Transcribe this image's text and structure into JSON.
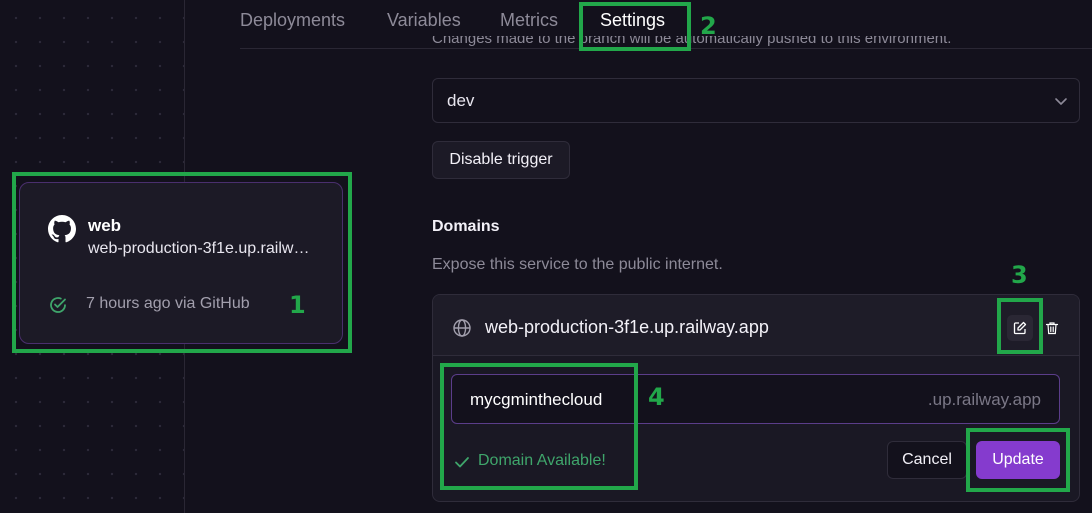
{
  "tabs": [
    {
      "label": "Deployments",
      "active": false
    },
    {
      "label": "Variables",
      "active": false
    },
    {
      "label": "Metrics",
      "active": false
    },
    {
      "label": "Settings",
      "active": true
    }
  ],
  "trigger": {
    "note_partial": "Changes made to the branch will be automatically pushed to this environment.",
    "branch_value": "dev",
    "disable_button": "Disable trigger"
  },
  "service_card": {
    "name": "web",
    "domain": "web-production-3f1e.up.railway.app",
    "status": "7 hours ago via GitHub",
    "icon": "github-icon",
    "status_icon": "check-circle-icon"
  },
  "domains": {
    "heading": "Domains",
    "description": "Expose this service to the public internet.",
    "current_domain": "web-production-3f1e.up.railway.app",
    "subdomain_value": "mycgminthecloud",
    "subdomain_suffix": ".up.railway.app",
    "availability": "Domain Available!",
    "cancel_label": "Cancel",
    "update_label": "Update"
  },
  "annotations": [
    "1",
    "2",
    "3",
    "4"
  ],
  "colors": {
    "background": "#13111c",
    "accent": "#853bce",
    "annotation": "#22a74a",
    "success": "#3fa56b"
  }
}
